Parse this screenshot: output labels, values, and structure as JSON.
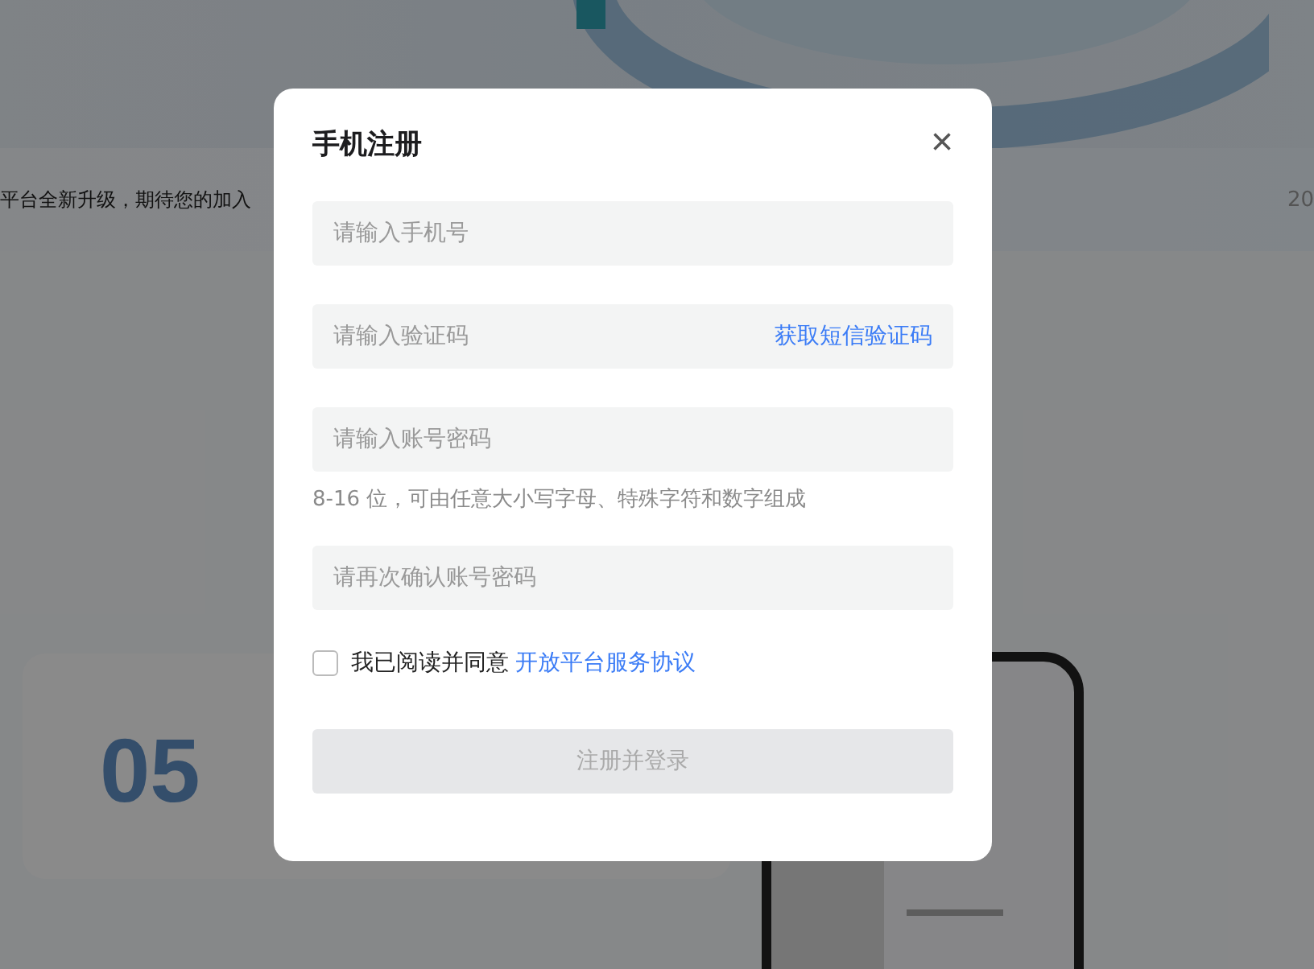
{
  "background": {
    "announcement": "平台全新升级，期待您的加入",
    "date_fragment": "20",
    "step_number": "05"
  },
  "dialog": {
    "title": "手机注册",
    "close": "×",
    "fields": [
      {
        "kind": "plain",
        "placeholder": "请输入手机号"
      },
      {
        "kind": "code",
        "placeholder": "请输入验证码",
        "action": "获取短信验证码"
      },
      {
        "kind": "plain",
        "placeholder": "请输入账号密码",
        "hint": "8-16 位，可由任意大小写字母、特殊字符和数字组成"
      },
      {
        "kind": "plain",
        "placeholder": "请再次确认账号密码"
      }
    ],
    "agreement": {
      "checked": false,
      "text": "我已阅读并同意",
      "link": "开放平台服务协议"
    },
    "submit": {
      "label": "注册并登录",
      "disabled": true
    }
  }
}
